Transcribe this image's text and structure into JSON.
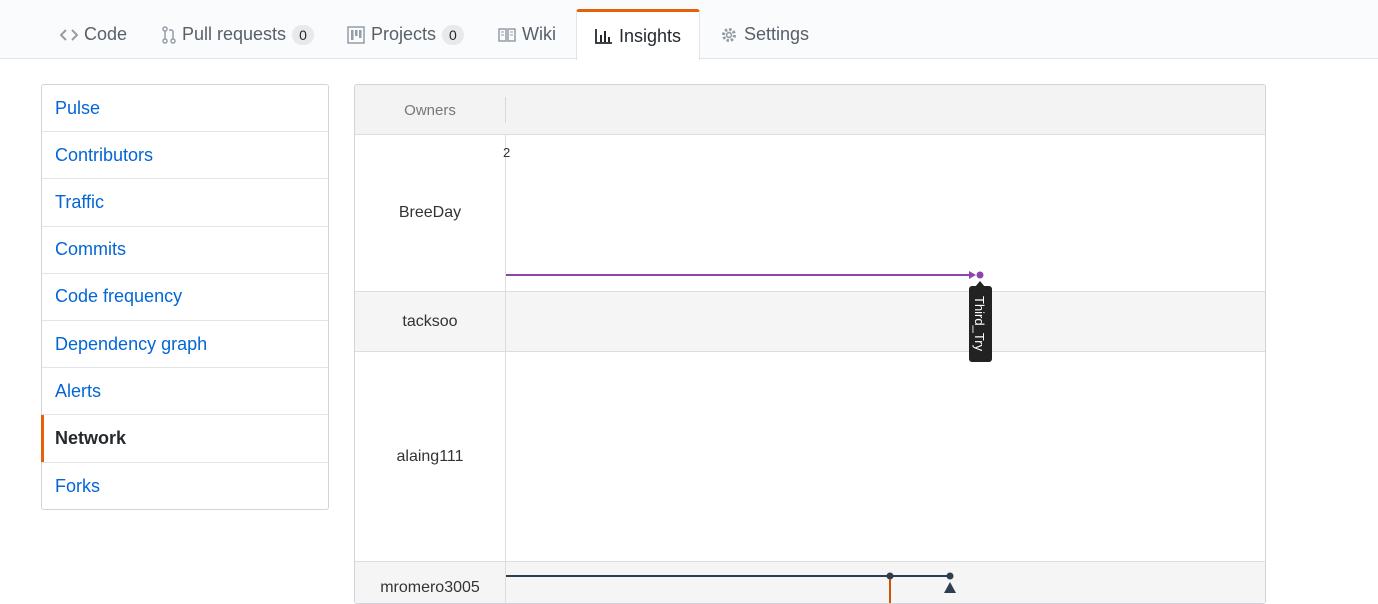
{
  "tabs": [
    {
      "label": "Code",
      "icon": "code-icon"
    },
    {
      "label": "Pull requests",
      "icon": "pull-request-icon",
      "count": "0"
    },
    {
      "label": "Projects",
      "icon": "project-icon",
      "count": "0"
    },
    {
      "label": "Wiki",
      "icon": "book-icon"
    },
    {
      "label": "Insights",
      "icon": "graph-icon",
      "selected": true
    },
    {
      "label": "Settings",
      "icon": "gear-icon"
    }
  ],
  "menu": {
    "items": [
      "Pulse",
      "Contributors",
      "Traffic",
      "Commits",
      "Code frequency",
      "Dependency graph",
      "Alerts",
      "Network",
      "Forks"
    ],
    "selected": "Network"
  },
  "network": {
    "owners_label": "Owners",
    "month_label": "2",
    "owners": [
      "BreeDay",
      "tacksoo",
      "alaing111",
      "mromero3005"
    ],
    "branch_tag": "Third_Try",
    "colors": {
      "breeday": "#8e44ad",
      "mromero": "#2c3e50",
      "merge": "#d35400",
      "accent": "#e36209"
    }
  }
}
